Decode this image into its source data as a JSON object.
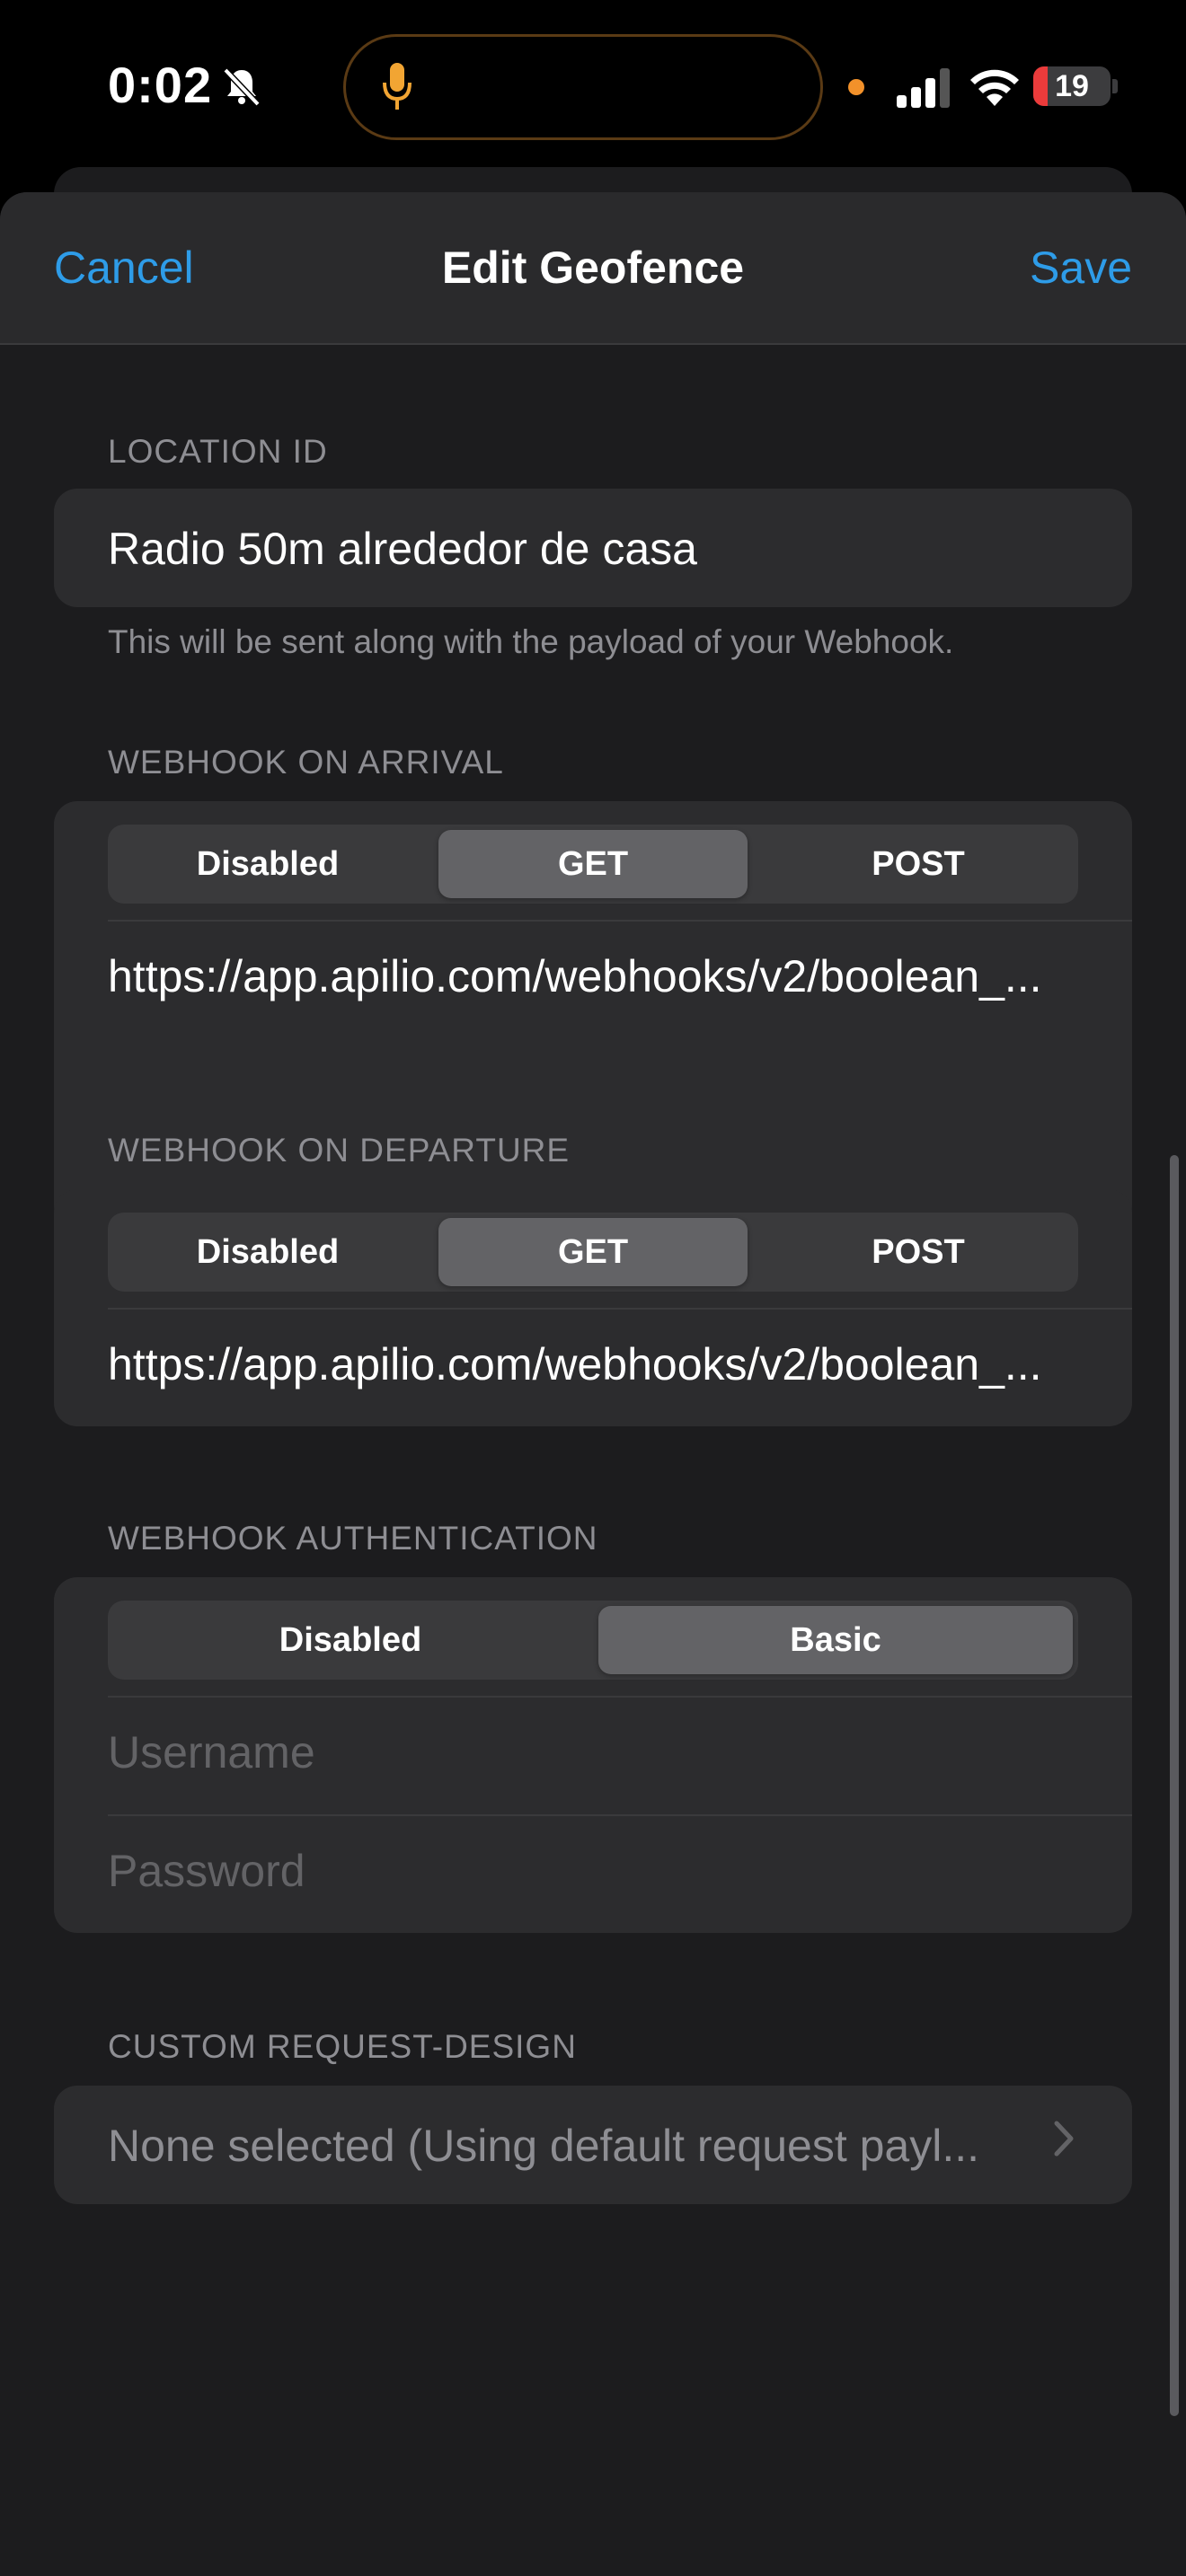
{
  "status_bar": {
    "time": "0:02",
    "battery_level": "19",
    "battery_fraction": 0.19,
    "icons": [
      "bell-slash-icon",
      "mic-icon",
      "signal-icon",
      "wifi-icon",
      "battery-icon"
    ]
  },
  "nav": {
    "cancel_label": "Cancel",
    "title": "Edit Geofence",
    "save_label": "Save"
  },
  "location": {
    "header": "LOCATION ID",
    "value": "Radio 50m alrededor de casa",
    "footer": "This will be sent along with the payload of your Webhook."
  },
  "arrival": {
    "header": "WEBHOOK ON ARRIVAL",
    "options": [
      "Disabled",
      "GET",
      "POST"
    ],
    "selected": "GET",
    "url": "https://app.apilio.com/webhooks/v2/boolean_..."
  },
  "departure": {
    "header": "WEBHOOK ON DEPARTURE",
    "options": [
      "Disabled",
      "GET",
      "POST"
    ],
    "selected": "GET",
    "url": "https://app.apilio.com/webhooks/v2/boolean_..."
  },
  "auth": {
    "header": "WEBHOOK AUTHENTICATION",
    "options": [
      "Disabled",
      "Basic"
    ],
    "selected": "Basic",
    "username_placeholder": "Username",
    "password_placeholder": "Password"
  },
  "custom_request": {
    "header": "CUSTOM REQUEST-DESIGN",
    "value": "None selected (Using default request payl..."
  },
  "colors": {
    "accent": "#2e9ce8",
    "background": "#1c1c1e",
    "cell": "#2c2c2e"
  }
}
